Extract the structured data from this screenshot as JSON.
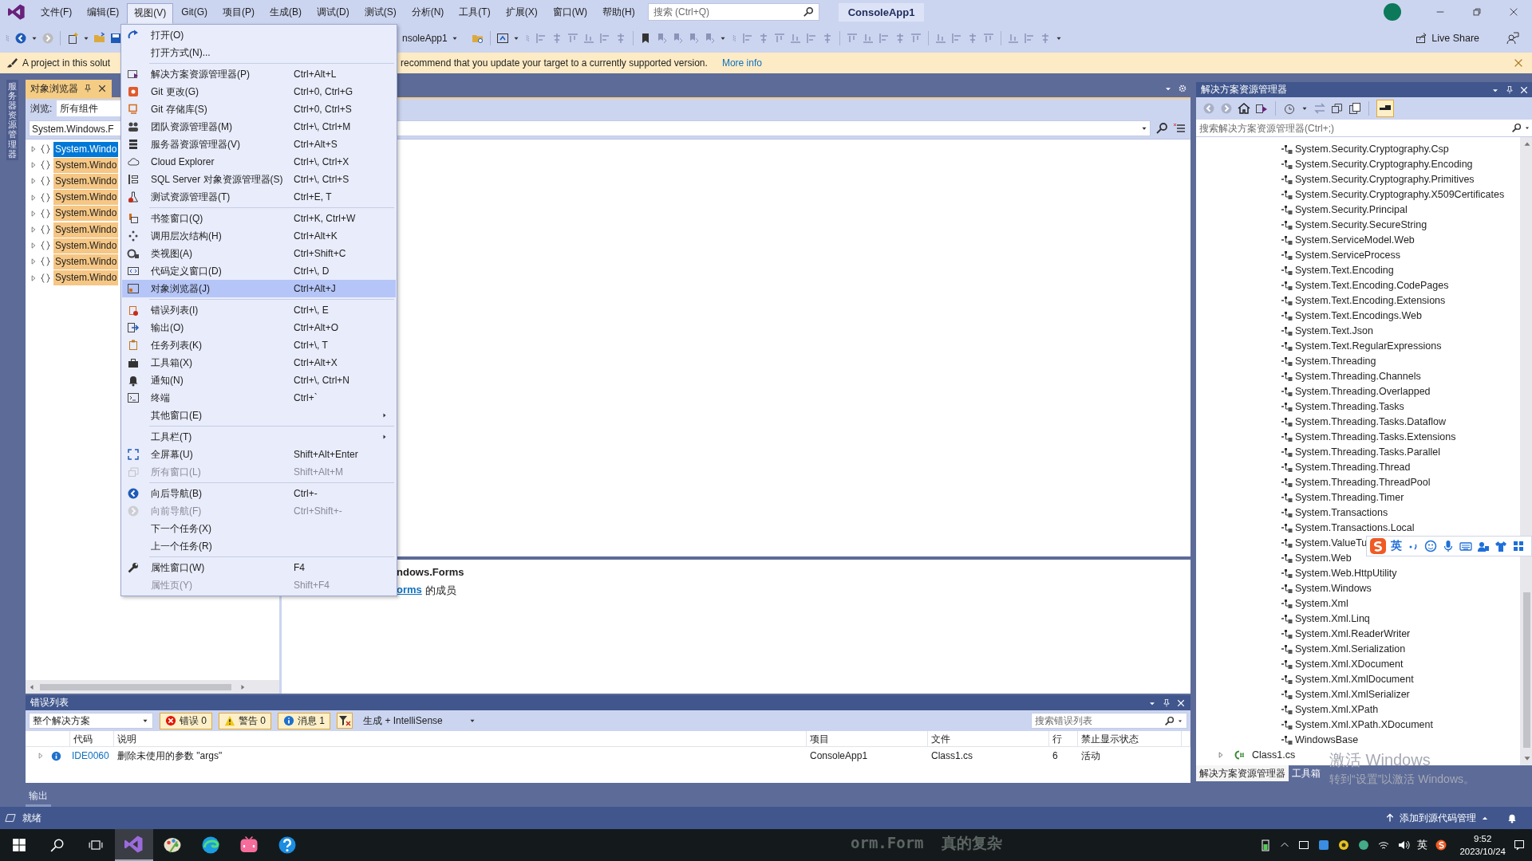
{
  "title_bar": {
    "menus": [
      {
        "label": "文件(F)",
        "selected": false
      },
      {
        "label": "编辑(E)",
        "selected": false
      },
      {
        "label": "视图(V)",
        "selected": true
      },
      {
        "label": "Git(G)",
        "selected": false
      },
      {
        "label": "项目(P)",
        "selected": false
      },
      {
        "label": "生成(B)",
        "selected": false
      },
      {
        "label": "调试(D)",
        "selected": false
      },
      {
        "label": "测试(S)",
        "selected": false
      },
      {
        "label": "分析(N)",
        "selected": false
      },
      {
        "label": "工具(T)",
        "selected": false
      },
      {
        "label": "扩展(X)",
        "selected": false
      },
      {
        "label": "窗口(W)",
        "selected": false
      },
      {
        "label": "帮助(H)",
        "selected": false
      }
    ],
    "search": {
      "placeholder": "搜索 (Ctrl+Q)"
    },
    "solution_name": "ConsoleApp1"
  },
  "toolbar": {
    "startup_project": "nsoleApp1",
    "live_share": "Live Share"
  },
  "info_bar": {
    "text_start": "A project in this solut",
    "text_end": "recommend that you update your target to a currently supported version.",
    "link": "More info"
  },
  "view_menu": {
    "items": [
      {
        "kind": "item",
        "label": "打开(O)",
        "disabled": false,
        "selected": false,
        "submenu": false
      },
      {
        "kind": "item",
        "label": "打开方式(N)...",
        "disabled": false,
        "selected": false,
        "submenu": false
      },
      {
        "kind": "separator"
      },
      {
        "kind": "item",
        "label": "解决方案资源管理器(P)",
        "shortcut": "Ctrl+Alt+L",
        "disabled": false,
        "selected": false,
        "submenu": false
      },
      {
        "kind": "item",
        "label": "Git 更改(G)",
        "shortcut": "Ctrl+0, Ctrl+G",
        "disabled": false,
        "selected": false,
        "submenu": false
      },
      {
        "kind": "item",
        "label": "Git 存储库(S)",
        "shortcut": "Ctrl+0, Ctrl+S",
        "disabled": false,
        "selected": false,
        "submenu": false
      },
      {
        "kind": "item",
        "label": "团队资源管理器(M)",
        "shortcut": "Ctrl+\\, Ctrl+M",
        "disabled": false,
        "selected": false,
        "submenu": false
      },
      {
        "kind": "item",
        "label": "服务器资源管理器(V)",
        "shortcut": "Ctrl+Alt+S",
        "disabled": false,
        "selected": false,
        "submenu": false
      },
      {
        "kind": "item",
        "label": "Cloud Explorer",
        "shortcut": "Ctrl+\\, Ctrl+X",
        "disabled": false,
        "selected": false,
        "submenu": false
      },
      {
        "kind": "item",
        "label": "SQL Server 对象资源管理器(S)",
        "shortcut": "Ctrl+\\, Ctrl+S",
        "disabled": false,
        "selected": false,
        "submenu": false
      },
      {
        "kind": "item",
        "label": "测试资源管理器(T)",
        "shortcut": "Ctrl+E, T",
        "disabled": false,
        "selected": false,
        "submenu": false
      },
      {
        "kind": "separator"
      },
      {
        "kind": "item",
        "label": "书签窗口(Q)",
        "shortcut": "Ctrl+K, Ctrl+W",
        "disabled": false,
        "selected": false,
        "submenu": false
      },
      {
        "kind": "item",
        "label": "调用层次结构(H)",
        "shortcut": "Ctrl+Alt+K",
        "disabled": false,
        "selected": false,
        "submenu": false
      },
      {
        "kind": "item",
        "label": "类视图(A)",
        "shortcut": "Ctrl+Shift+C",
        "disabled": false,
        "selected": false,
        "submenu": false
      },
      {
        "kind": "item",
        "label": "代码定义窗口(D)",
        "shortcut": "Ctrl+\\, D",
        "disabled": false,
        "selected": false,
        "submenu": false
      },
      {
        "kind": "item",
        "label": "对象浏览器(J)",
        "shortcut": "Ctrl+Alt+J",
        "disabled": false,
        "selected": true,
        "submenu": false
      },
      {
        "kind": "separator"
      },
      {
        "kind": "item",
        "label": "错误列表(I)",
        "shortcut": "Ctrl+\\, E",
        "disabled": false,
        "selected": false,
        "submenu": false
      },
      {
        "kind": "item",
        "label": "输出(O)",
        "shortcut": "Ctrl+Alt+O",
        "disabled": false,
        "selected": false,
        "submenu": false
      },
      {
        "kind": "item",
        "label": "任务列表(K)",
        "shortcut": "Ctrl+\\, T",
        "disabled": false,
        "selected": false,
        "submenu": false
      },
      {
        "kind": "item",
        "label": "工具箱(X)",
        "shortcut": "Ctrl+Alt+X",
        "disabled": false,
        "selected": false,
        "submenu": false
      },
      {
        "kind": "item",
        "label": "通知(N)",
        "shortcut": "Ctrl+\\, Ctrl+N",
        "disabled": false,
        "selected": false,
        "submenu": false
      },
      {
        "kind": "item",
        "label": "终端",
        "shortcut": "Ctrl+`",
        "disabled": false,
        "selected": false,
        "submenu": false
      },
      {
        "kind": "item",
        "label": "其他窗口(E)",
        "disabled": false,
        "selected": false,
        "submenu": true
      },
      {
        "kind": "separator"
      },
      {
        "kind": "item",
        "label": "工具栏(T)",
        "disabled": false,
        "selected": false,
        "submenu": true
      },
      {
        "kind": "item",
        "label": "全屏幕(U)",
        "shortcut": "Shift+Alt+Enter",
        "disabled": false,
        "selected": false,
        "submenu": false
      },
      {
        "kind": "item",
        "label": "所有窗口(L)",
        "shortcut": "Shift+Alt+M",
        "disabled": true,
        "selected": false,
        "submenu": false
      },
      {
        "kind": "separator"
      },
      {
        "kind": "item",
        "label": "向后导航(B)",
        "shortcut": "Ctrl+-",
        "disabled": false,
        "selected": false,
        "submenu": false
      },
      {
        "kind": "item",
        "label": "向前导航(F)",
        "shortcut": "Ctrl+Shift+-",
        "disabled": true,
        "selected": false,
        "submenu": false
      },
      {
        "kind": "item",
        "label": "下一个任务(X)",
        "disabled": false,
        "selected": false,
        "submenu": false
      },
      {
        "kind": "item",
        "label": "上一个任务(R)",
        "disabled": false,
        "selected": false,
        "submenu": false
      },
      {
        "kind": "separator"
      },
      {
        "kind": "item",
        "label": "属性窗口(W)",
        "shortcut": "F4",
        "disabled": false,
        "selected": false,
        "submenu": false
      },
      {
        "kind": "item",
        "label": "属性页(Y)",
        "shortcut": "Shift+F4",
        "disabled": true,
        "selected": false,
        "submenu": false
      }
    ]
  },
  "side_strip": {
    "tabs": [
      {
        "label": "服务器资源管理器"
      }
    ]
  },
  "object_browser": {
    "tab": {
      "label": "对象浏览器",
      "selected": true
    },
    "browse_label": "浏览:",
    "browse_value": "所有组件",
    "search_value": "System.Windows.F",
    "tree": [
      {
        "label": "System.Windo",
        "selected": true,
        "expanded": false
      },
      {
        "label": "System.Windo",
        "selected": false,
        "expanded": false
      },
      {
        "label": "System.Windo",
        "selected": false,
        "expanded": false
      },
      {
        "label": "System.Windo",
        "selected": false,
        "expanded": false
      },
      {
        "label": "System.Windo",
        "selected": false,
        "expanded": false
      },
      {
        "label": "System.Windo",
        "selected": false,
        "expanded": false
      },
      {
        "label": "System.Windo",
        "selected": false,
        "expanded": false
      },
      {
        "label": "System.Windo",
        "selected": false,
        "expanded": false
      },
      {
        "label": "System.Windo",
        "selected": false,
        "expanded": false
      }
    ],
    "description": {
      "title": "ndows.Forms",
      "link": "orms",
      "text": "的成员"
    }
  },
  "error_list": {
    "title": "错误列表",
    "scope": "整个解决方案",
    "filters": [
      {
        "kind": "error",
        "label": "错误 0",
        "on": true
      },
      {
        "kind": "warning",
        "label": "警告 0",
        "on": true
      },
      {
        "kind": "message",
        "label": "消息 1",
        "on": true
      }
    ],
    "source": "生成 + IntelliSense",
    "search": {
      "placeholder": "搜索错误列表"
    },
    "columns": [
      "代码",
      "说明",
      "项目",
      "文件",
      "行",
      "禁止显示状态"
    ],
    "rows": [
      {
        "kind": "info",
        "expanded": false,
        "code": "IDE0060",
        "description": "删除未使用的参数 \"args\"",
        "project": "ConsoleApp1",
        "file": "Class1.cs",
        "line": "6",
        "state": "活动"
      }
    ]
  },
  "bottom_tabs": [
    {
      "label": "输出",
      "selected": false
    }
  ],
  "solution_explorer": {
    "title": "解决方案资源管理器",
    "search": {
      "placeholder": "搜索解决方案资源管理器(Ctrl+;)"
    },
    "references": [
      "System.Security.Cryptography.Csp",
      "System.Security.Cryptography.Encoding",
      "System.Security.Cryptography.Primitives",
      "System.Security.Cryptography.X509Certificates",
      "System.Security.Principal",
      "System.Security.SecureString",
      "System.ServiceModel.Web",
      "System.ServiceProcess",
      "System.Text.Encoding",
      "System.Text.Encoding.CodePages",
      "System.Text.Encoding.Extensions",
      "System.Text.Encodings.Web",
      "System.Text.Json",
      "System.Text.RegularExpressions",
      "System.Threading",
      "System.Threading.Channels",
      "System.Threading.Overlapped",
      "System.Threading.Tasks",
      "System.Threading.Tasks.Dataflow",
      "System.Threading.Tasks.Extensions",
      "System.Threading.Tasks.Parallel",
      "System.Threading.Thread",
      "System.Threading.ThreadPool",
      "System.Threading.Timer",
      "System.Transactions",
      "System.Transactions.Local",
      "System.ValueTu",
      "System.Web",
      "System.Web.HttpUtility",
      "System.Windows",
      "System.Xml",
      "System.Xml.Linq",
      "System.Xml.ReaderWriter",
      "System.Xml.Serialization",
      "System.Xml.XDocument",
      "System.Xml.XmlDocument",
      "System.Xml.XmlSerializer",
      "System.Xml.XPath",
      "System.Xml.XPath.XDocument",
      "WindowsBase"
    ],
    "files": [
      {
        "label": "Class1.cs",
        "expanded": false
      }
    ],
    "tabs": [
      {
        "label": "解决方案资源管理器",
        "selected": true
      },
      {
        "label": "工具箱",
        "selected": false
      }
    ]
  },
  "status_bar": {
    "text": "就绪",
    "source_control": "添加到源代码管理"
  },
  "ime_toolbar": {
    "mode": "英"
  },
  "activation": {
    "title": "激活 Windows",
    "text": "转到“设置”以激活 Windows。"
  },
  "taskbar": {
    "background_text": "orm.Form  真的复杂",
    "ime": "英",
    "time": "9:52",
    "date": "2023/10/24"
  }
}
